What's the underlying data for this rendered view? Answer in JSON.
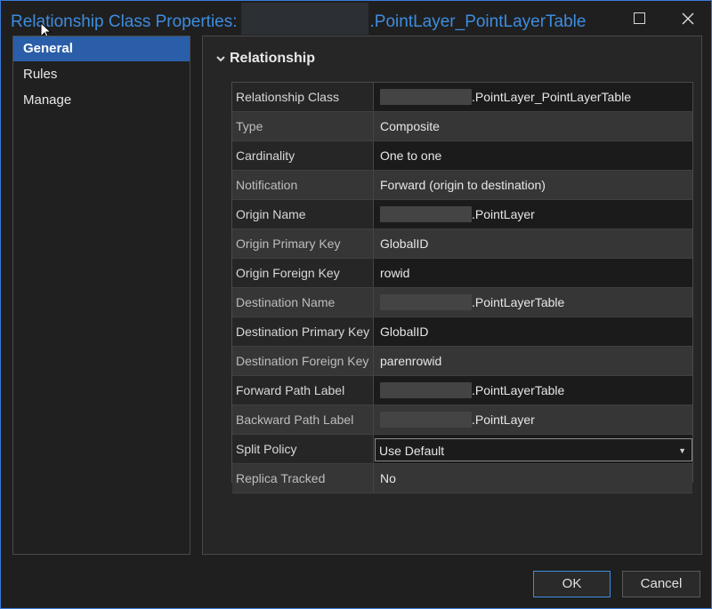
{
  "window": {
    "title_prefix": "Relationship Class Properties:",
    "title_suffix": ".PointLayer_PointLayerTable"
  },
  "nav": {
    "items": [
      {
        "label": "General",
        "active": true
      },
      {
        "label": "Rules",
        "active": false
      },
      {
        "label": "Manage",
        "active": false
      }
    ]
  },
  "section": {
    "title": "Relationship"
  },
  "properties": [
    {
      "label": "Relationship Class",
      "value": ".PointLayer_PointLayerTable",
      "redacted": true
    },
    {
      "label": "Type",
      "value": "Composite"
    },
    {
      "label": "Cardinality",
      "value": "One to one"
    },
    {
      "label": "Notification",
      "value": "Forward (origin to destination)"
    },
    {
      "label": "Origin Name",
      "value": ".PointLayer",
      "redacted": true
    },
    {
      "label": "Origin Primary Key",
      "value": "GlobalID"
    },
    {
      "label": "Origin Foreign Key",
      "value": "rowid"
    },
    {
      "label": "Destination Name",
      "value": ".PointLayerTable",
      "redacted": true
    },
    {
      "label": "Destination Primary Key",
      "value": "GlobalID"
    },
    {
      "label": "Destination Foreign Key",
      "value": "parenrowid"
    },
    {
      "label": "Forward Path Label",
      "value": ".PointLayerTable",
      "redacted": true
    },
    {
      "label": "Backward Path Label",
      "value": ".PointLayer",
      "redacted": true
    },
    {
      "label": "Split Policy",
      "value": "Use Default",
      "dropdown": true
    },
    {
      "label": "Replica Tracked",
      "value": "No"
    }
  ],
  "buttons": {
    "ok": "OK",
    "cancel": "Cancel"
  },
  "icons": {
    "maximize": "maximize-icon",
    "close": "close-icon",
    "section_toggle": "chevron-down-icon",
    "dropdown": "caret-down-icon"
  },
  "colors": {
    "accent": "#3d8de0",
    "selected_nav": "#2a5ea8"
  }
}
